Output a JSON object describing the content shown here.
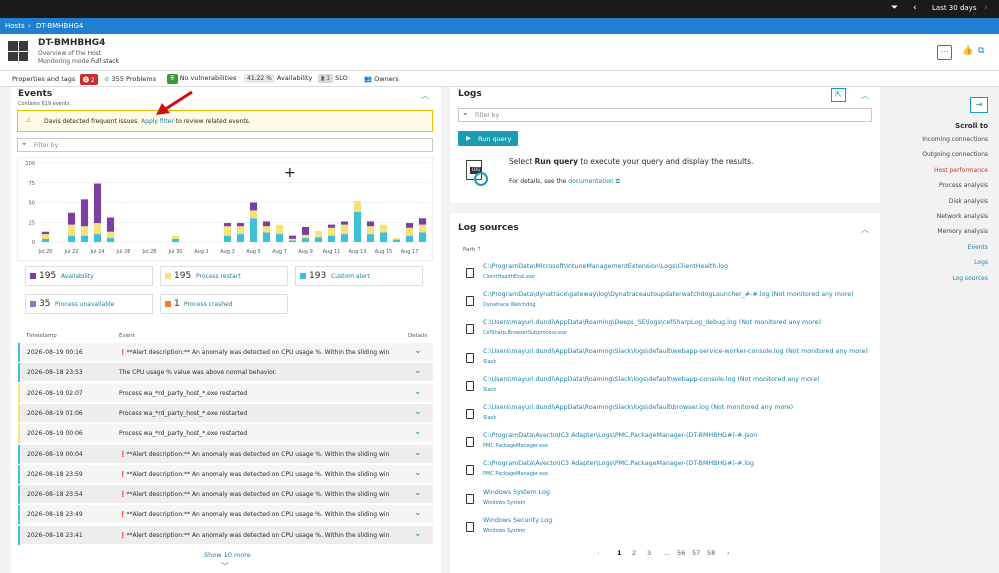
{
  "topbar": {
    "timeframe": "Last 30 days"
  },
  "breadcrumb": {
    "root": "Hosts",
    "current": "DT-BMHBHG4"
  },
  "host": {
    "name": "DT-BMHBHG4",
    "subtitle": "Overview of the Host",
    "mode_label": "Monitoring mode",
    "mode_value": "Full stack"
  },
  "infobar": {
    "properties": "Properties and tags",
    "problems_count": "2",
    "problems_total": "355",
    "problems_label": "Problems",
    "vulnerabilities": "No vulnerabilities",
    "availability_pct": "41.22 %",
    "availability_label": "Availability",
    "slo_count": "1",
    "slo_label": "SLO",
    "owners": "Owners"
  },
  "events": {
    "title": "Events",
    "count_text": "Contains 619 events.",
    "warn_prefix": "Davis detected frequent issues.",
    "warn_link": "Apply filter",
    "warn_suffix": "to review related events.",
    "filter_placeholder": "Filter by",
    "tiles": [
      {
        "num": "195",
        "label": "Availability",
        "color": "#7b3fa0"
      },
      {
        "num": "195",
        "label": "Process restart",
        "color": "#f5e27a"
      },
      {
        "num": "193",
        "label": "Custom alert",
        "color": "#3ec0d6"
      },
      {
        "num": "35",
        "label": "Process unavailable",
        "color": "#9b6fc0"
      },
      {
        "num": "1",
        "label": "Process crashed",
        "color": "#f07d28"
      }
    ],
    "columns": {
      "timestamp": "Timestamp",
      "event": "Event",
      "details": "Details"
    },
    "rows": [
      {
        "ts": "2026–08–19 00:16",
        "ev": "❗**Alert description:** An anomaly was detected on CPU usage %. Within the sliding win",
        "color": "#3ec0d6"
      },
      {
        "ts": "2026–08–18 23:53",
        "ev": "The CPU usage % value was above normal behavior.",
        "color": "#3ec0d6"
      },
      {
        "ts": "2026–08–19 02:07",
        "ev": "Process wa_*rd_party_host_*.exe restarted",
        "color": "#f5e27a"
      },
      {
        "ts": "2026–08–19 01:06",
        "ev": "Process wa_*rd_party_host_*.exe restarted",
        "color": "#f5e27a"
      },
      {
        "ts": "2026–08–19 00:06",
        "ev": "Process wa_*rd_party_host_*.exe restarted",
        "color": "#f5e27a"
      },
      {
        "ts": "2026–08–19 00:04",
        "ev": "❗**Alert description:** An anomaly was detected on CPU usage %. Within the sliding win",
        "color": "#3ec0d6"
      },
      {
        "ts": "2026–08–18 23:59",
        "ev": "❗**Alert description:** An anomaly was detected on CPU usage %. Within the sliding win",
        "color": "#3ec0d6"
      },
      {
        "ts": "2026–08–18 23:54",
        "ev": "❗**Alert description:** An anomaly was detected on CPU usage %. Within the sliding win",
        "color": "#3ec0d6"
      },
      {
        "ts": "2026–08–18 23:49",
        "ev": "❗**Alert description:** An anomaly was detected on CPU usage %. Within the sliding win",
        "color": "#3ec0d6"
      },
      {
        "ts": "2026–08–18 23:41",
        "ev": "❗**Alert description:** An anomaly was detected on CPU usage %. Within the sliding win",
        "color": "#3ec0d6"
      }
    ],
    "show_more": "Show 10 more"
  },
  "chart_data": {
    "type": "bar",
    "categories": [
      "Jul 20",
      "",
      "Jul 22",
      "",
      "Jul 24",
      "",
      "Jul 26",
      "",
      "Jul 28",
      "",
      "Jul 30",
      "",
      "Aug 1",
      "",
      "Aug 3",
      "",
      "Aug 5",
      "",
      "Aug 7",
      "",
      "Aug 9",
      "",
      "Aug 11",
      "",
      "Aug 13",
      "",
      "Aug 15",
      "",
      "Aug 17",
      ""
    ],
    "ylim": [
      0,
      100
    ],
    "yticks": [
      "100",
      "75",
      "50",
      "25",
      "0"
    ],
    "series": [
      {
        "name": "Custom alert",
        "color": "#3ec0d6",
        "values": [
          4,
          0,
          8,
          8,
          10,
          5,
          0,
          0,
          0,
          0,
          4,
          0,
          0,
          0,
          8,
          10,
          30,
          12,
          10,
          2,
          5,
          6,
          8,
          10,
          38,
          10,
          12,
          3,
          8,
          12
        ]
      },
      {
        "name": "Process restart",
        "color": "#f5e27a",
        "values": [
          6,
          0,
          14,
          12,
          14,
          8,
          0,
          0,
          0,
          0,
          4,
          0,
          0,
          0,
          12,
          10,
          10,
          8,
          12,
          2,
          4,
          8,
          10,
          12,
          14,
          10,
          10,
          2,
          10,
          10
        ]
      },
      {
        "name": "Availability",
        "color": "#7b3fa0",
        "values": [
          3,
          0,
          15,
          34,
          50,
          18,
          0,
          0,
          0,
          0,
          0,
          0,
          0,
          0,
          4,
          4,
          10,
          6,
          0,
          4,
          10,
          0,
          4,
          4,
          0,
          6,
          0,
          0,
          6,
          8
        ]
      }
    ]
  },
  "logs": {
    "title": "Logs",
    "filter_placeholder": "Filter by",
    "run_query": "Run query",
    "prompt_prefix": "Select",
    "prompt_bold": "Run query",
    "prompt_suffix": "to execute your query and display the results.",
    "details_prefix": "For details, see the",
    "details_link": "documentation"
  },
  "log_sources": {
    "title": "Log sources",
    "col_path": "Path",
    "items": [
      {
        "path": "C:\\ProgramData\\Microsoft\\IntuneManagementExtension\\Logs\\ClientHealth.log",
        "source": "ClientHealthEval.exe"
      },
      {
        "path": "C:\\ProgramData\\dynatrace\\gateway\\log\\DynatraceautoupdaterwatchdogLauncher_#-#.log (Not monitored any more)",
        "source": "Dynatrace Watchdog"
      },
      {
        "path": "C:\\Users\\mayuri.dundi\\AppData\\Roaming\\DeepL_SE\\logs\\cefSharpLog_debug.log (Not monitored any more)",
        "source": "CefSharp.BrowserSubprocess.exe"
      },
      {
        "path": "C:\\Users\\mayuri.dundi\\AppData\\Roaming\\Slack\\logs\\default\\webapp-service-worker-console.log (Not monitored any more)",
        "source": "Slack"
      },
      {
        "path": "C:\\Users\\mayuri.dundi\\AppData\\Roaming\\Slack\\logs\\default\\webapp-console.log (Not monitored any more)",
        "source": "Slack"
      },
      {
        "path": "C:\\Users\\mayuri.dundi\\AppData\\Roaming\\Slack\\logs\\default\\browser.log (Not monitored any more)",
        "source": "Slack"
      },
      {
        "path": "C:\\ProgramData\\Avecto\\IC3 Adapter\\Logs\\PMC.PackageManager-(DT-BMHBHG#)-#.json",
        "source": "PMC.PackageManager.exe"
      },
      {
        "path": "C:\\ProgramData\\Avecto\\IC3 Adapter\\Logs\\PMC.PackageManager-(DT-BMHBHG#)-#.log",
        "source": "PMC.PackageManager.exe"
      },
      {
        "path": "Windows System Log",
        "source": "Windows System"
      },
      {
        "path": "Windows Security Log",
        "source": "Windows System"
      }
    ],
    "pages": [
      "1",
      "2",
      "3",
      "...",
      "56",
      "57",
      "58"
    ]
  },
  "scroll_to": {
    "title": "Scroll to",
    "items": [
      "Incoming connections",
      "Outgoing connections",
      "Host performance",
      "Process analysis",
      "Disk analysis",
      "Network analysis",
      "Memory analysis",
      "Events",
      "Logs",
      "Log sources"
    ],
    "active_color": "#d0342c"
  }
}
